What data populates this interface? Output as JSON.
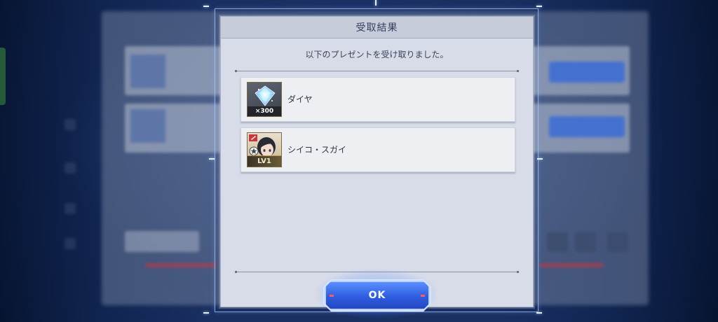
{
  "dialog": {
    "title": "受取結果",
    "message": "以下のプレゼントを受け取りました。",
    "items": [
      {
        "name": "ダイヤ",
        "icon": "diamond-icon",
        "quantity_badge": "×300"
      },
      {
        "name": "シイコ・スガイ",
        "icon": "character-portrait-icon",
        "level_badge": "LV1"
      }
    ],
    "ok_label": "OK"
  },
  "colors": {
    "dialog_bg": "#d7dce8",
    "title_bar": "#c6ccda",
    "ok_button": "#2e5de0",
    "background": "#0b1838"
  }
}
